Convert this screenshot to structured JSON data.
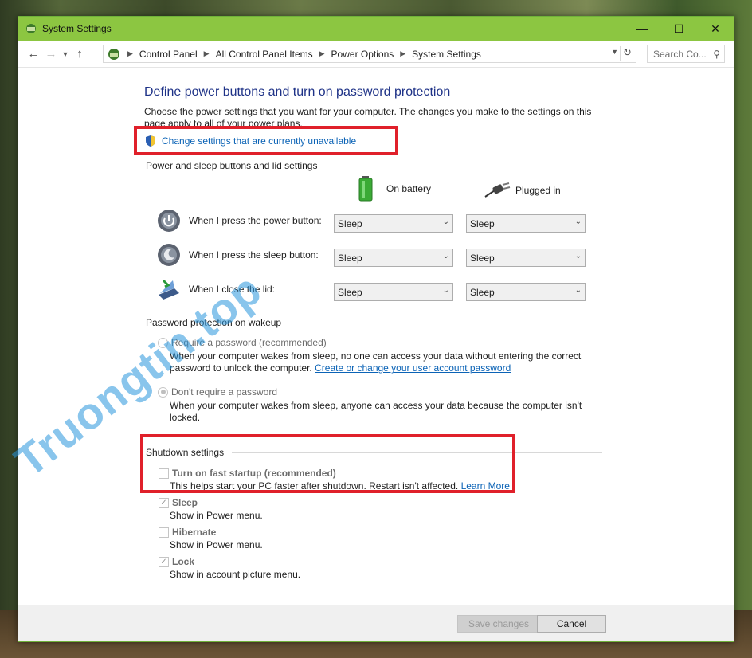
{
  "window": {
    "title": "System Settings"
  },
  "nav": {
    "breadcrumbs": [
      "Control Panel",
      "All Control Panel Items",
      "Power Options",
      "System Settings"
    ],
    "search_placeholder": "Search Co..."
  },
  "page": {
    "heading": "Define power buttons and turn on password protection",
    "description": "Choose the power settings that you want for your computer. The changes you make to the settings on this page apply to all of your power plans.",
    "change_link": "Change settings that are currently unavailable"
  },
  "power": {
    "section_title": "Power and sleep buttons and lid settings",
    "col_battery": "On battery",
    "col_plugged": "Plugged in",
    "rows": [
      {
        "label": "When I press the power button:",
        "battery": "Sleep",
        "plugged": "Sleep"
      },
      {
        "label": "When I press the sleep button:",
        "battery": "Sleep",
        "plugged": "Sleep"
      },
      {
        "label": "When I close the lid:",
        "battery": "Sleep",
        "plugged": "Sleep"
      }
    ]
  },
  "password": {
    "section_title": "Password protection on wakeup",
    "require_label": "Require a password (recommended)",
    "require_desc": "When your computer wakes from sleep, no one can access your data without entering the correct password to unlock the computer.",
    "require_link": "Create or change your user account password",
    "norequire_label": "Don't require a password",
    "norequire_desc": "When your computer wakes from sleep, anyone can access your data because the computer isn't locked.",
    "selected": "norequire"
  },
  "shutdown": {
    "section_title": "Shutdown settings",
    "items": [
      {
        "label": "Turn on fast startup (recommended)",
        "desc": "This helps start your PC faster after shutdown. Restart isn't affected.",
        "link": "Learn More",
        "checked": false
      },
      {
        "label": "Sleep",
        "desc": "Show in Power menu.",
        "checked": true
      },
      {
        "label": "Hibernate",
        "desc": "Show in Power menu.",
        "checked": false
      },
      {
        "label": "Lock",
        "desc": "Show in account picture menu.",
        "checked": true
      }
    ]
  },
  "footer": {
    "save": "Save changes",
    "cancel": "Cancel"
  },
  "watermark": "Truongtin.top",
  "colors": {
    "titlebar": "#8cc641",
    "highlight": "#e0202a",
    "link": "#0b63b6",
    "heading": "#1e3287"
  }
}
